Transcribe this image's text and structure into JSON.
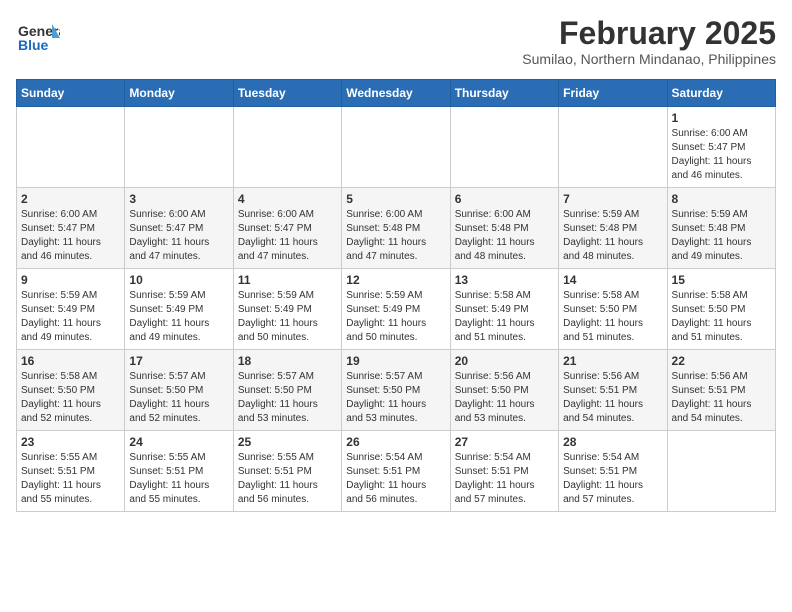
{
  "header": {
    "logo_general": "General",
    "logo_blue": "Blue",
    "month_year": "February 2025",
    "location": "Sumilao, Northern Mindanao, Philippines"
  },
  "weekdays": [
    "Sunday",
    "Monday",
    "Tuesday",
    "Wednesday",
    "Thursday",
    "Friday",
    "Saturday"
  ],
  "weeks": [
    [
      {
        "day": "",
        "info": ""
      },
      {
        "day": "",
        "info": ""
      },
      {
        "day": "",
        "info": ""
      },
      {
        "day": "",
        "info": ""
      },
      {
        "day": "",
        "info": ""
      },
      {
        "day": "",
        "info": ""
      },
      {
        "day": "1",
        "info": "Sunrise: 6:00 AM\nSunset: 5:47 PM\nDaylight: 11 hours\nand 46 minutes."
      }
    ],
    [
      {
        "day": "2",
        "info": "Sunrise: 6:00 AM\nSunset: 5:47 PM\nDaylight: 11 hours\nand 46 minutes."
      },
      {
        "day": "3",
        "info": "Sunrise: 6:00 AM\nSunset: 5:47 PM\nDaylight: 11 hours\nand 47 minutes."
      },
      {
        "day": "4",
        "info": "Sunrise: 6:00 AM\nSunset: 5:47 PM\nDaylight: 11 hours\nand 47 minutes."
      },
      {
        "day": "5",
        "info": "Sunrise: 6:00 AM\nSunset: 5:48 PM\nDaylight: 11 hours\nand 47 minutes."
      },
      {
        "day": "6",
        "info": "Sunrise: 6:00 AM\nSunset: 5:48 PM\nDaylight: 11 hours\nand 48 minutes."
      },
      {
        "day": "7",
        "info": "Sunrise: 5:59 AM\nSunset: 5:48 PM\nDaylight: 11 hours\nand 48 minutes."
      },
      {
        "day": "8",
        "info": "Sunrise: 5:59 AM\nSunset: 5:48 PM\nDaylight: 11 hours\nand 49 minutes."
      }
    ],
    [
      {
        "day": "9",
        "info": "Sunrise: 5:59 AM\nSunset: 5:49 PM\nDaylight: 11 hours\nand 49 minutes."
      },
      {
        "day": "10",
        "info": "Sunrise: 5:59 AM\nSunset: 5:49 PM\nDaylight: 11 hours\nand 49 minutes."
      },
      {
        "day": "11",
        "info": "Sunrise: 5:59 AM\nSunset: 5:49 PM\nDaylight: 11 hours\nand 50 minutes."
      },
      {
        "day": "12",
        "info": "Sunrise: 5:59 AM\nSunset: 5:49 PM\nDaylight: 11 hours\nand 50 minutes."
      },
      {
        "day": "13",
        "info": "Sunrise: 5:58 AM\nSunset: 5:49 PM\nDaylight: 11 hours\nand 51 minutes."
      },
      {
        "day": "14",
        "info": "Sunrise: 5:58 AM\nSunset: 5:50 PM\nDaylight: 11 hours\nand 51 minutes."
      },
      {
        "day": "15",
        "info": "Sunrise: 5:58 AM\nSunset: 5:50 PM\nDaylight: 11 hours\nand 51 minutes."
      }
    ],
    [
      {
        "day": "16",
        "info": "Sunrise: 5:58 AM\nSunset: 5:50 PM\nDaylight: 11 hours\nand 52 minutes."
      },
      {
        "day": "17",
        "info": "Sunrise: 5:57 AM\nSunset: 5:50 PM\nDaylight: 11 hours\nand 52 minutes."
      },
      {
        "day": "18",
        "info": "Sunrise: 5:57 AM\nSunset: 5:50 PM\nDaylight: 11 hours\nand 53 minutes."
      },
      {
        "day": "19",
        "info": "Sunrise: 5:57 AM\nSunset: 5:50 PM\nDaylight: 11 hours\nand 53 minutes."
      },
      {
        "day": "20",
        "info": "Sunrise: 5:56 AM\nSunset: 5:50 PM\nDaylight: 11 hours\nand 53 minutes."
      },
      {
        "day": "21",
        "info": "Sunrise: 5:56 AM\nSunset: 5:51 PM\nDaylight: 11 hours\nand 54 minutes."
      },
      {
        "day": "22",
        "info": "Sunrise: 5:56 AM\nSunset: 5:51 PM\nDaylight: 11 hours\nand 54 minutes."
      }
    ],
    [
      {
        "day": "23",
        "info": "Sunrise: 5:55 AM\nSunset: 5:51 PM\nDaylight: 11 hours\nand 55 minutes."
      },
      {
        "day": "24",
        "info": "Sunrise: 5:55 AM\nSunset: 5:51 PM\nDaylight: 11 hours\nand 55 minutes."
      },
      {
        "day": "25",
        "info": "Sunrise: 5:55 AM\nSunset: 5:51 PM\nDaylight: 11 hours\nand 56 minutes."
      },
      {
        "day": "26",
        "info": "Sunrise: 5:54 AM\nSunset: 5:51 PM\nDaylight: 11 hours\nand 56 minutes."
      },
      {
        "day": "27",
        "info": "Sunrise: 5:54 AM\nSunset: 5:51 PM\nDaylight: 11 hours\nand 57 minutes."
      },
      {
        "day": "28",
        "info": "Sunrise: 5:54 AM\nSunset: 5:51 PM\nDaylight: 11 hours\nand 57 minutes."
      },
      {
        "day": "",
        "info": ""
      }
    ]
  ]
}
